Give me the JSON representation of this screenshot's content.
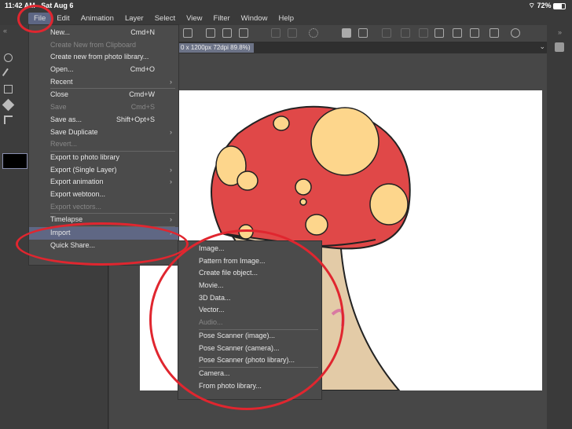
{
  "status": {
    "time": "11:42 AM",
    "date": "Sat Aug 6",
    "battery": "72%"
  },
  "menubar": [
    "File",
    "Edit",
    "Animation",
    "Layer",
    "Select",
    "View",
    "Filter",
    "Window",
    "Help"
  ],
  "tab": {
    "label": "0 x 1200px 72dpi 89.8%)"
  },
  "file_menu": [
    {
      "label": "New...",
      "key": "Cmd+N"
    },
    {
      "label": "Create New from Clipboard",
      "disabled": true
    },
    {
      "label": "Create new from photo library..."
    },
    {
      "label": "Open...",
      "key": "Cmd+O"
    },
    {
      "label": "Recent",
      "submenu": true,
      "sep_after": true
    },
    {
      "label": "Close",
      "key": "Cmd+W"
    },
    {
      "label": "Save",
      "key": "Cmd+S",
      "disabled": true
    },
    {
      "label": "Save as...",
      "key": "Shift+Opt+S"
    },
    {
      "label": "Save Duplicate",
      "submenu": true
    },
    {
      "label": "Revert...",
      "disabled": true,
      "sep_after": true
    },
    {
      "label": "Export to photo library"
    },
    {
      "label": "Export (Single Layer)",
      "submenu": true
    },
    {
      "label": "Export animation",
      "submenu": true
    },
    {
      "label": "Export webtoon..."
    },
    {
      "label": "Export vectors...",
      "disabled": true,
      "sep_after": true
    },
    {
      "label": "Timelapse",
      "submenu": true,
      "sep_after": true
    },
    {
      "label": "Import",
      "submenu": true,
      "highlighted": true
    },
    {
      "label": "Quick Share..."
    }
  ],
  "import_menu": [
    {
      "label": "Image..."
    },
    {
      "label": "Pattern from Image..."
    },
    {
      "label": "Create file object..."
    },
    {
      "label": "Movie..."
    },
    {
      "label": "3D Data..."
    },
    {
      "label": "Vector..."
    },
    {
      "label": "Audio...",
      "disabled": true,
      "sep_after": true
    },
    {
      "label": "Pose Scanner (image)..."
    },
    {
      "label": "Pose Scanner (camera)..."
    },
    {
      "label": "Pose Scanner (photo library)...",
      "sep_after": true
    },
    {
      "label": "Camera..."
    },
    {
      "label": "From photo library..."
    }
  ],
  "colors": {
    "accent": "#5f6784",
    "annotation": "#e0262f",
    "cap": "#e04848",
    "spots": "#fdd68c",
    "stem": "#e3cba7"
  }
}
